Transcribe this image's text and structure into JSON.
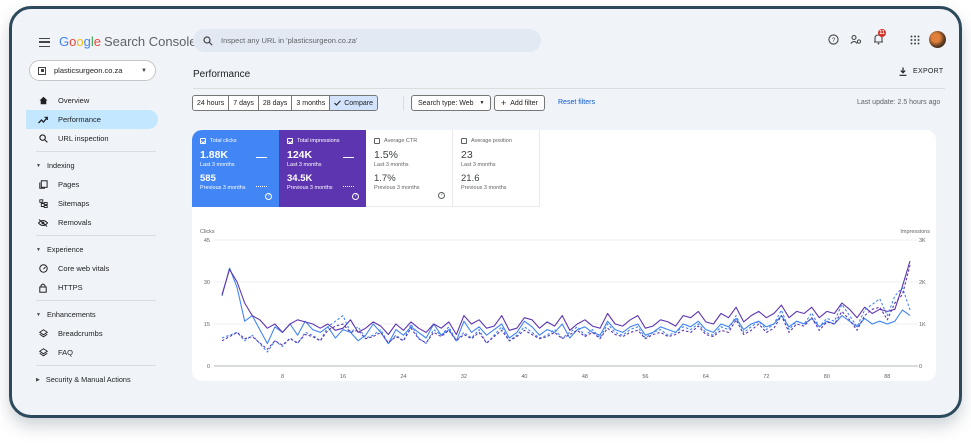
{
  "app": {
    "logo_letters": [
      "G",
      "o",
      "o",
      "g",
      "l",
      "e"
    ],
    "product": "Search Console",
    "search_placeholder": "Inspect any URL in 'plasticsurgeon.co.za'",
    "notification_count": "11"
  },
  "sidebar": {
    "property": "plasticsurgeon.co.za",
    "items": [
      {
        "label": "Overview",
        "icon": "home-icon"
      },
      {
        "label": "Performance",
        "icon": "trending-up-icon",
        "active": true
      },
      {
        "label": "URL inspection",
        "icon": "search-icon"
      }
    ],
    "sections": [
      {
        "label": "Indexing",
        "items": [
          {
            "label": "Pages",
            "icon": "pages-icon"
          },
          {
            "label": "Sitemaps",
            "icon": "sitemap-icon"
          },
          {
            "label": "Removals",
            "icon": "removals-icon"
          }
        ]
      },
      {
        "label": "Experience",
        "items": [
          {
            "label": "Core web vitals",
            "icon": "gauge-icon"
          },
          {
            "label": "HTTPS",
            "icon": "lock-icon"
          }
        ]
      },
      {
        "label": "Enhancements",
        "items": [
          {
            "label": "Breadcrumbs",
            "icon": "layers-icon"
          },
          {
            "label": "FAQ",
            "icon": "layers-icon"
          }
        ]
      },
      {
        "label": "Security & Manual Actions",
        "items": []
      }
    ]
  },
  "main": {
    "title": "Performance",
    "export_label": "EXPORT",
    "date_ranges": [
      "24 hours",
      "7 days",
      "28 days",
      "3 months",
      "Compare"
    ],
    "selected_range": "Compare",
    "search_type": "Search type: Web",
    "add_filter": "Add filter",
    "reset_filters": "Reset filters",
    "last_update": "Last update: 2.5 hours ago"
  },
  "metrics": [
    {
      "label": "Total clicks",
      "value": "1.88K",
      "period": "Last 3 months",
      "prev_value": "585",
      "prev_period": "Previous 3 months",
      "checked": true,
      "color": "#4285f4"
    },
    {
      "label": "Total impressions",
      "value": "124K",
      "period": "Last 3 months",
      "prev_value": "34.5K",
      "prev_period": "Previous 3 months",
      "checked": true,
      "color": "#5e35b1"
    },
    {
      "label": "Average CTR",
      "value": "1.5%",
      "period": "Last 3 months",
      "prev_value": "1.7%",
      "prev_period": "Previous 3 months",
      "checked": false
    },
    {
      "label": "Average position",
      "value": "23",
      "period": "Last 3 months",
      "prev_value": "21.6",
      "prev_period": "Previous 3 months",
      "checked": false
    }
  ],
  "chart_data": {
    "type": "line",
    "left_axis": {
      "label": "Clicks",
      "ticks": [
        0,
        15,
        30,
        45
      ],
      "range": [
        0,
        45
      ]
    },
    "right_axis": {
      "label": "Impressions",
      "ticks": [
        "0",
        "1K",
        "2K",
        "3K"
      ],
      "range": [
        0,
        3000
      ]
    },
    "x_ticks": [
      8,
      16,
      24,
      32,
      40,
      48,
      56,
      64,
      72,
      80,
      88
    ],
    "x_range": [
      0,
      91
    ],
    "series": [
      {
        "color": "#4285f4",
        "axis": "left",
        "dashed": false,
        "values": [
          25,
          35,
          28,
          16,
          18,
          13,
          8,
          14,
          12,
          15,
          11,
          16,
          13,
          12,
          14,
          10,
          13,
          12,
          9,
          11,
          15,
          12,
          8,
          13,
          11,
          14,
          12,
          10,
          15,
          11,
          13,
          9,
          16,
          12,
          14,
          11,
          13,
          15,
          10,
          12,
          16,
          14,
          11,
          13,
          12,
          15,
          10,
          13,
          14,
          12,
          11,
          16,
          13,
          12,
          14,
          15,
          11,
          12,
          14,
          13,
          12,
          15,
          14,
          16,
          13,
          12,
          15,
          14,
          17,
          13,
          15,
          16,
          14,
          15,
          18,
          14,
          16,
          15,
          17,
          14,
          16,
          15,
          18,
          16,
          14,
          17,
          15,
          16,
          15,
          16,
          20,
          18
        ]
      },
      {
        "color": "#5e35b1",
        "axis": "right",
        "dashed": false,
        "values": [
          1700,
          2300,
          2000,
          1500,
          1200,
          1100,
          900,
          1000,
          800,
          1000,
          1100,
          1050,
          1000,
          900,
          1000,
          850,
          900,
          1100,
          800,
          900,
          1050,
          950,
          750,
          1000,
          850,
          1050,
          900,
          800,
          1000,
          900,
          1050,
          750,
          1200,
          1000,
          1100,
          900,
          950,
          1200,
          850,
          900,
          1150,
          1100,
          900,
          1050,
          950,
          1200,
          850,
          1000,
          1100,
          950,
          900,
          1250,
          1000,
          950,
          1100,
          1200,
          900,
          950,
          1100,
          1050,
          950,
          1200,
          1150,
          1300,
          1050,
          1000,
          1250,
          1150,
          1400,
          1050,
          1200,
          1300,
          1150,
          1250,
          1450,
          1150,
          1300,
          1250,
          1400,
          1150,
          1300,
          1250,
          1500,
          1350,
          1150,
          1400,
          1250,
          1350,
          1300,
          1350,
          1900,
          2500
        ]
      },
      {
        "color": "#4285f4",
        "axis": "left",
        "dashed": true,
        "values": [
          10,
          11,
          12,
          9,
          11,
          8,
          5,
          9,
          7,
          10,
          8,
          12,
          11,
          9,
          14,
          16,
          18,
          12,
          14,
          10,
          11,
          13,
          8,
          11,
          9,
          15,
          10,
          8,
          13,
          11,
          14,
          9,
          12,
          10,
          13,
          8,
          11,
          14,
          9,
          11,
          14,
          12,
          10,
          11,
          13,
          10,
          12,
          14,
          11,
          13,
          10,
          15,
          12,
          11,
          13,
          14,
          10,
          12,
          13,
          11,
          12,
          14,
          13,
          15,
          12,
          11,
          14,
          13,
          18,
          12,
          14,
          16,
          13,
          15,
          20,
          13,
          16,
          15,
          19,
          14,
          17,
          16,
          22,
          18,
          14,
          20,
          22,
          24,
          18,
          25,
          28,
          20
        ]
      },
      {
        "color": "#5e35b1",
        "axis": "right",
        "dashed": true,
        "values": [
          600,
          700,
          800,
          650,
          700,
          550,
          400,
          600,
          500,
          650,
          550,
          750,
          700,
          600,
          850,
          950,
          1000,
          800,
          850,
          650,
          700,
          800,
          550,
          700,
          600,
          900,
          650,
          550,
          800,
          700,
          850,
          600,
          750,
          650,
          800,
          550,
          700,
          850,
          600,
          700,
          850,
          750,
          650,
          700,
          800,
          650,
          750,
          850,
          700,
          800,
          650,
          900,
          750,
          700,
          800,
          850,
          650,
          750,
          800,
          700,
          750,
          850,
          800,
          950,
          750,
          700,
          850,
          800,
          1100,
          750,
          850,
          1000,
          800,
          900,
          1200,
          800,
          1000,
          950,
          1150,
          850,
          1050,
          1000,
          1300,
          1100,
          850,
          1200,
          1350,
          1400,
          1100,
          1500,
          1700,
          2400
        ]
      }
    ]
  }
}
